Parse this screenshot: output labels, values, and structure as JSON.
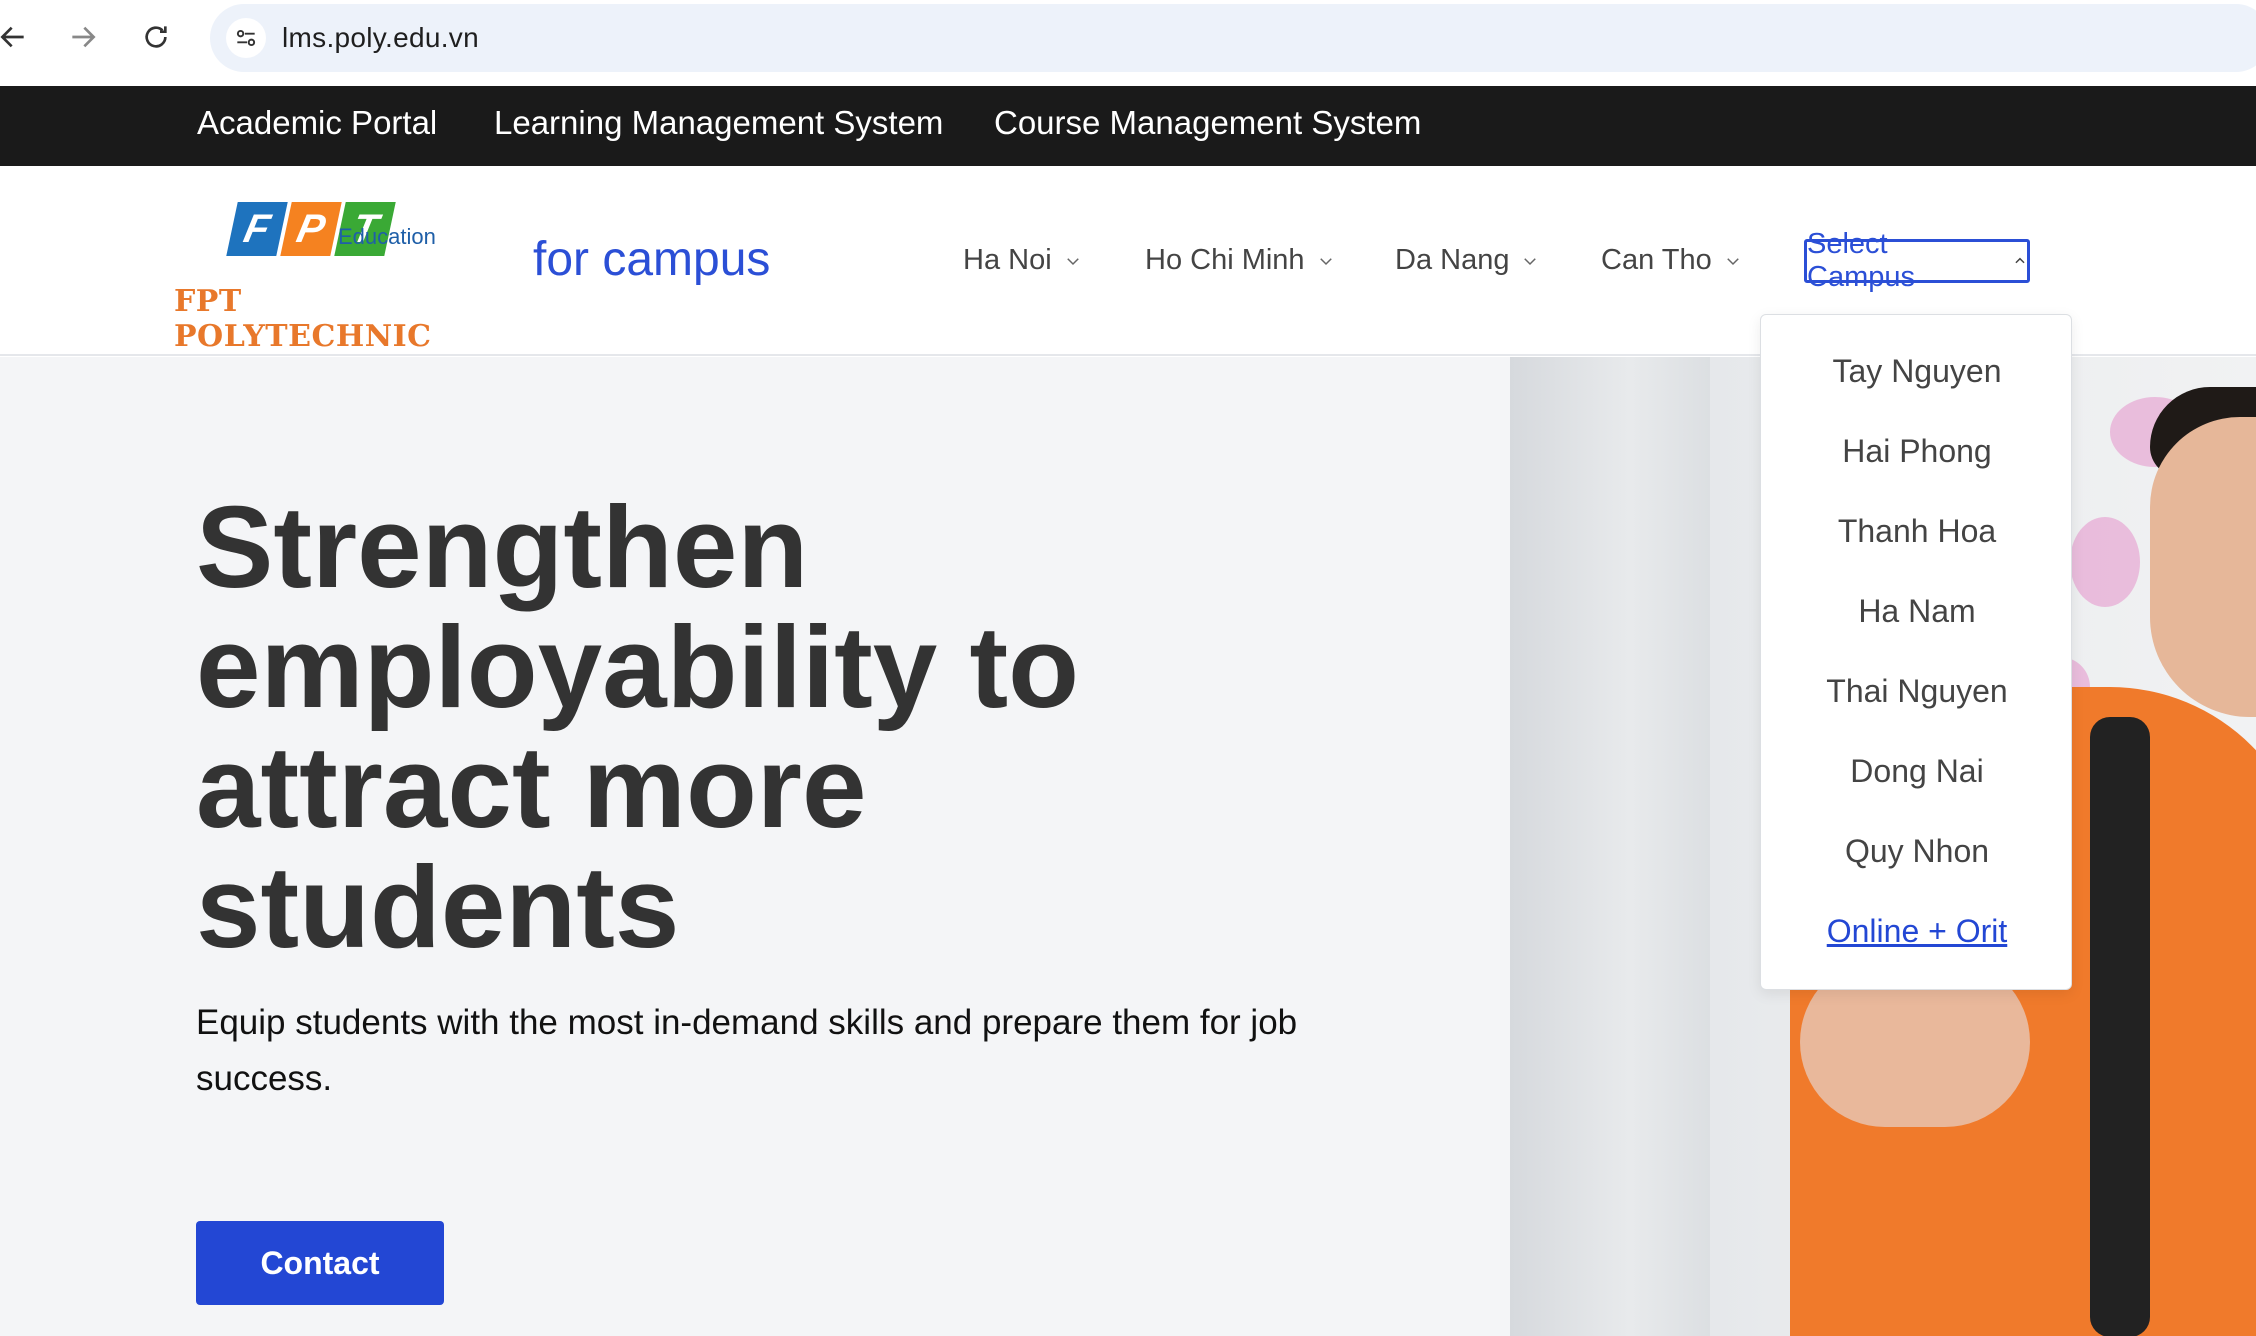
{
  "browser": {
    "url": "lms.poly.edu.vn"
  },
  "portal_bar": {
    "links": [
      "Academic Portal",
      "Learning Management System",
      "Course Management System"
    ]
  },
  "header": {
    "logo": {
      "brand": "FPT",
      "edu": "Education",
      "school": "FPT POLYTECHNIC",
      "colors": [
        "#1e73be",
        "#f58220",
        "#3aa935"
      ]
    },
    "tagline": "for campus",
    "menu": [
      "Ha Noi",
      "Ho Chi Minh",
      "Da Nang",
      "Can Tho"
    ],
    "select_campus": "Select Campus"
  },
  "dropdown": {
    "items": [
      "Tay Nguyen",
      "Hai Phong",
      "Thanh Hoa",
      "Ha Nam",
      "Thai Nguyen",
      "Dong Nai",
      "Quy Nhon",
      "Online + Orit"
    ]
  },
  "hero": {
    "title": "Strengthen employability to attract more students",
    "subtitle": "Equip students with the most in-demand skills and prepare them for job success.",
    "cta": "Contact"
  },
  "colors": {
    "accent": "#2347d4",
    "portal_bg": "#1a1a1a",
    "hero_bg": "#f4f5f7"
  }
}
